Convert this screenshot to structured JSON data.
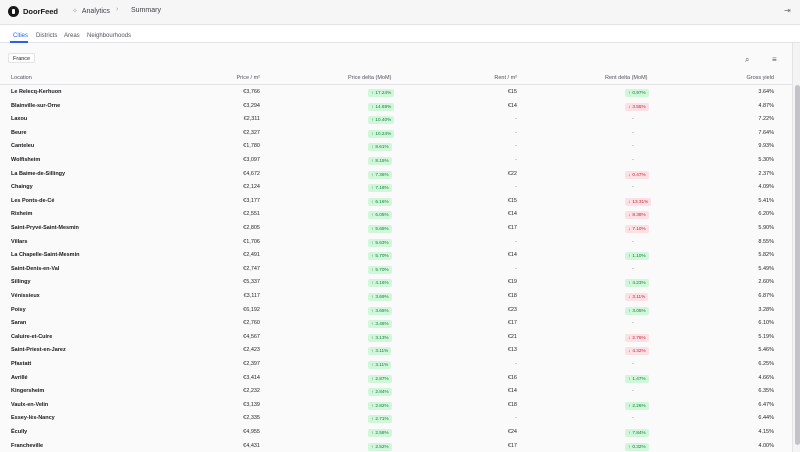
{
  "app": {
    "brand": "DoorFeed",
    "nav_item": "Analytics",
    "breadcrumb": "Summary"
  },
  "icons": {
    "logo": "doorfeed-logo-icon",
    "analytics": "analytics-icon",
    "chevron": "chevron-right-icon",
    "logout": "logout-icon",
    "search": "search-icon",
    "filter": "filter-icon"
  },
  "tabs": [
    "Cities",
    "Districts",
    "Areas",
    "Neighbourhoods"
  ],
  "active_tab": "Cities",
  "filter_chip": "France",
  "columns": {
    "location": "Location",
    "price": "Price / m²",
    "price_delta": "Price delta (MoM)",
    "rent": "Rent / m²",
    "rent_delta": "Rent delta (MoM)",
    "yield": "Gross yield"
  },
  "colors": {
    "accent": "#2563eb",
    "positive": "#157a3a",
    "positive_bg": "#d1f7db",
    "negative": "#c0263d",
    "negative_bg": "#fde0e4"
  },
  "rows": [
    {
      "location": "Le Relecq-Kerhuon",
      "price": "€3,766",
      "price_delta": "17.24%",
      "rent": "€15",
      "rent_delta": "0.97%",
      "rent_dir": "up",
      "yield": "3.64%"
    },
    {
      "location": "Blainville-sur-Orne",
      "price": "€3,294",
      "price_delta": "14.69%",
      "rent": "€14",
      "rent_delta": "3.55%",
      "rent_dir": "down",
      "yield": "4.87%"
    },
    {
      "location": "Laxou",
      "price": "€2,311",
      "price_delta": "10.40%",
      "rent": "-",
      "rent_delta": "-",
      "rent_dir": "",
      "yield": "7.22%"
    },
    {
      "location": "Beure",
      "price": "€2,327",
      "price_delta": "10.24%",
      "rent": "-",
      "rent_delta": "-",
      "rent_dir": "",
      "yield": "7.64%"
    },
    {
      "location": "Canteleu",
      "price": "€1,780",
      "price_delta": "8.61%",
      "rent": "-",
      "rent_delta": "-",
      "rent_dir": "",
      "yield": "9.93%"
    },
    {
      "location": "Wolfisheim",
      "price": "€3,097",
      "price_delta": "8.15%",
      "rent": "-",
      "rent_delta": "-",
      "rent_dir": "",
      "yield": "5.30%"
    },
    {
      "location": "La Baime-de-Sillingy",
      "price": "€4,672",
      "price_delta": "7.36%",
      "rent": "€22",
      "rent_delta": "0.47%",
      "rent_dir": "down",
      "yield": "2.37%"
    },
    {
      "location": "Chaingy",
      "price": "€2,124",
      "price_delta": "7.18%",
      "rent": "-",
      "rent_delta": "-",
      "rent_dir": "",
      "yield": "4.09%"
    },
    {
      "location": "Les Ponts-de-Cé",
      "price": "€3,177",
      "price_delta": "6.16%",
      "rent": "€15",
      "rent_delta": "13.31%",
      "rent_dir": "down",
      "yield": "5.41%"
    },
    {
      "location": "Rixheim",
      "price": "€2,551",
      "price_delta": "6.05%",
      "rent": "€14",
      "rent_delta": "8.38%",
      "rent_dir": "down",
      "yield": "6.20%"
    },
    {
      "location": "Saint-Pryvé-Saint-Mesmin",
      "price": "€2,805",
      "price_delta": "5.65%",
      "rent": "€17",
      "rent_delta": "7.10%",
      "rent_dir": "down",
      "yield": "5.90%"
    },
    {
      "location": "Villars",
      "price": "€1,706",
      "price_delta": "5.63%",
      "rent": "-",
      "rent_delta": "-",
      "rent_dir": "",
      "yield": "8.55%"
    },
    {
      "location": "La Chapelle-Saint-Mesmin",
      "price": "€2,491",
      "price_delta": "5.70%",
      "rent": "€14",
      "rent_delta": "1.10%",
      "rent_dir": "up",
      "yield": "5.82%"
    },
    {
      "location": "Saint-Denis-en-Val",
      "price": "€2,747",
      "price_delta": "5.70%",
      "rent": "-",
      "rent_delta": "-",
      "rent_dir": "",
      "yield": "5.49%"
    },
    {
      "location": "Sillingy",
      "price": "€5,337",
      "price_delta": "4.16%",
      "rent": "€19",
      "rent_delta": "4.23%",
      "rent_dir": "up",
      "yield": "2.60%"
    },
    {
      "location": "Vénissieux",
      "price": "€3,117",
      "price_delta": "3.69%",
      "rent": "€18",
      "rent_delta": "3.11%",
      "rent_dir": "down",
      "yield": "6.87%"
    },
    {
      "location": "Poisy",
      "price": "€6,192",
      "price_delta": "3.65%",
      "rent": "€23",
      "rent_delta": "3.05%",
      "rent_dir": "up",
      "yield": "3.28%"
    },
    {
      "location": "Saran",
      "price": "€2,760",
      "price_delta": "3.46%",
      "rent": "€17",
      "rent_delta": "-",
      "rent_dir": "",
      "yield": "6.10%"
    },
    {
      "location": "Caluire-et-Cuire",
      "price": "€4,567",
      "price_delta": "3.13%",
      "rent": "€21",
      "rent_delta": "2.76%",
      "rent_dir": "down",
      "yield": "5.19%"
    },
    {
      "location": "Saint-Priest-en-Jarez",
      "price": "€2,423",
      "price_delta": "3.11%",
      "rent": "€13",
      "rent_delta": "4.32%",
      "rent_dir": "down",
      "yield": "5.46%"
    },
    {
      "location": "Pfastatt",
      "price": "€2,397",
      "price_delta": "3.11%",
      "rent": "-",
      "rent_delta": "-",
      "rent_dir": "",
      "yield": "6.25%"
    },
    {
      "location": "Avrillé",
      "price": "€3,414",
      "price_delta": "2.87%",
      "rent": "€16",
      "rent_delta": "1.47%",
      "rent_dir": "up",
      "yield": "4.66%"
    },
    {
      "location": "Kingersheim",
      "price": "€2,232",
      "price_delta": "2.84%",
      "rent": "€14",
      "rent_delta": "-",
      "rent_dir": "",
      "yield": "6.35%"
    },
    {
      "location": "Vaulx-en-Velin",
      "price": "€3,139",
      "price_delta": "2.82%",
      "rent": "€18",
      "rent_delta": "2.26%",
      "rent_dir": "up",
      "yield": "6.47%"
    },
    {
      "location": "Essey-lès-Nancy",
      "price": "€2,335",
      "price_delta": "2.71%",
      "rent": "-",
      "rent_delta": "-",
      "rent_dir": "",
      "yield": "6.44%"
    },
    {
      "location": "Écully",
      "price": "€4,955",
      "price_delta": "2.58%",
      "rent": "€24",
      "rent_delta": "7.84%",
      "rent_dir": "up",
      "yield": "4.15%"
    },
    {
      "location": "Francheville",
      "price": "€4,431",
      "price_delta": "2.52%",
      "rent": "€17",
      "rent_delta": "0.32%",
      "rent_dir": "up",
      "yield": "4.00%"
    }
  ]
}
